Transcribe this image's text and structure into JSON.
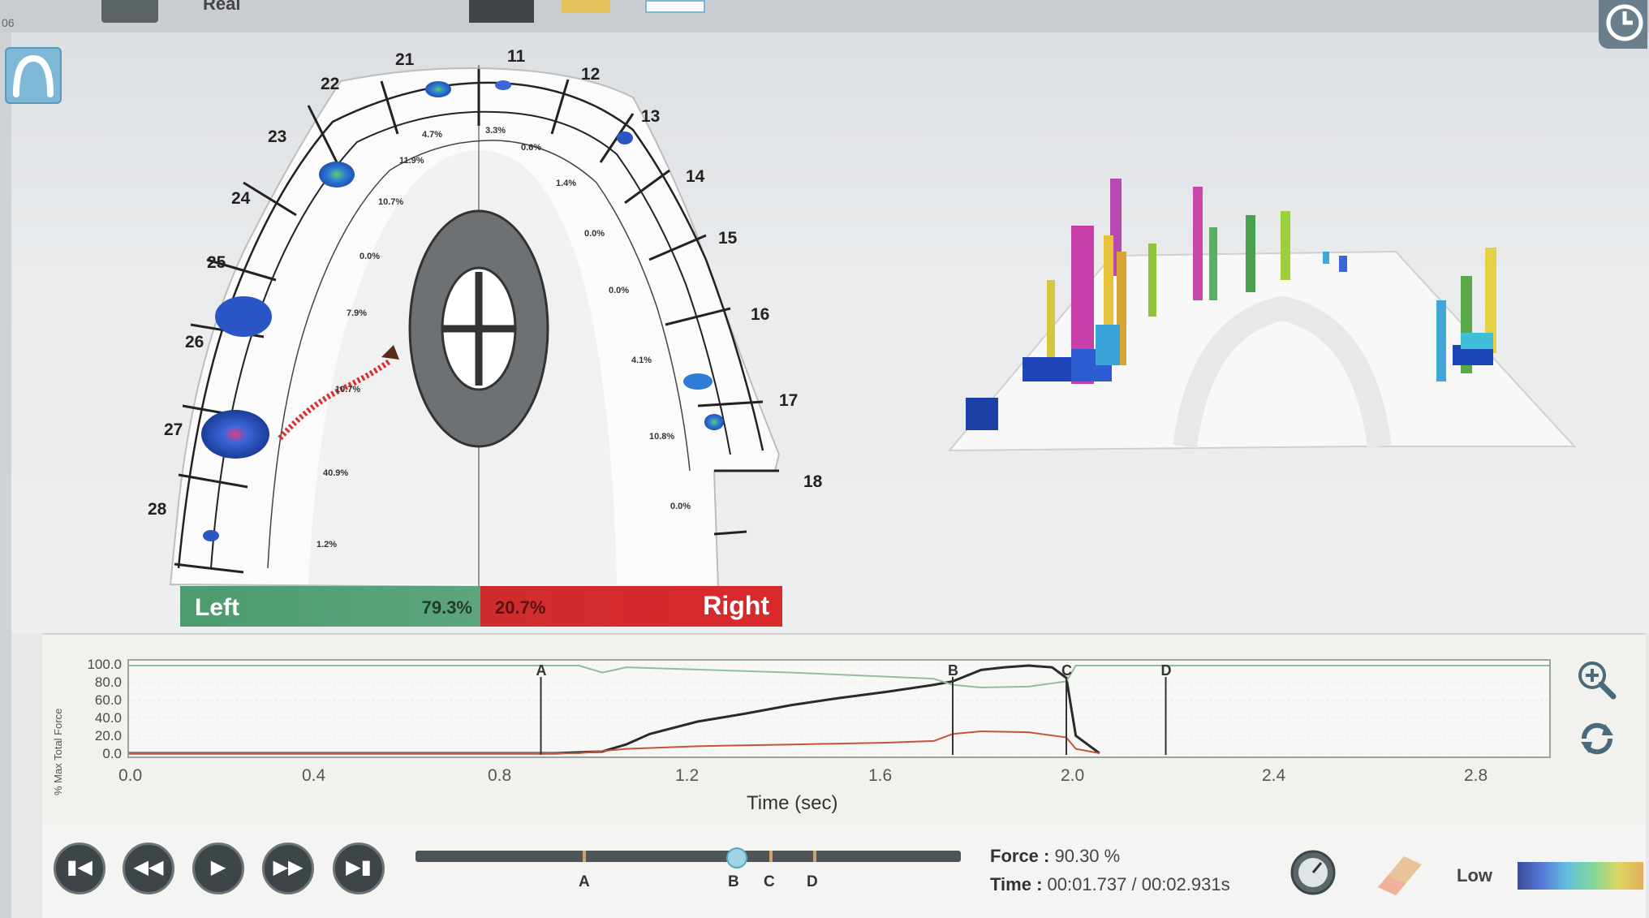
{
  "window": {
    "top_left_text": "06",
    "top_menu_label": "Real"
  },
  "arch": {
    "left_teeth": [
      "21",
      "22",
      "23",
      "24",
      "25",
      "26",
      "27",
      "28"
    ],
    "right_teeth": [
      "11",
      "12",
      "13",
      "14",
      "15",
      "16",
      "17",
      "18"
    ],
    "left_percents": [
      "4.7%",
      "11.9%",
      "10.7%",
      "0.0%",
      "7.9%",
      "10.7%",
      "40.9%",
      "1.2%"
    ],
    "right_percents": [
      "3.3%",
      "0.6%",
      "1.4%",
      "0.0%",
      "0.0%",
      "4.1%",
      "10.8%",
      "0.0%"
    ]
  },
  "balance": {
    "left_label": "Left",
    "left_value": "79.3%",
    "right_label": "Right",
    "right_value": "20.7%",
    "left_color": "#4a9a6e",
    "right_color": "#d8282c"
  },
  "graph": {
    "ylabel": "% Max Total Force",
    "xlabel": "Time (sec)",
    "y_ticks": [
      "100.0",
      "80.0",
      "60.0",
      "40.0",
      "20.0",
      "0.0"
    ],
    "x_ticks": [
      "0.0",
      "0.4",
      "0.8",
      "1.2",
      "1.6",
      "2.0",
      "2.4",
      "2.8"
    ],
    "markers": [
      "A",
      "B",
      "C",
      "D"
    ]
  },
  "chart_data": {
    "type": "line",
    "xlabel": "Time (sec)",
    "ylabel": "% Max Total Force",
    "xlim": [
      0,
      3.0
    ],
    "ylim": [
      0,
      100
    ],
    "markers": [
      {
        "label": "A",
        "x": 0.87
      },
      {
        "label": "B",
        "x": 1.74
      },
      {
        "label": "C",
        "x": 1.98
      },
      {
        "label": "D",
        "x": 2.19
      }
    ],
    "series": [
      {
        "color": "#2a2a2a",
        "x": [
          0.0,
          0.9,
          1.0,
          1.05,
          1.1,
          1.2,
          1.3,
          1.4,
          1.5,
          1.6,
          1.7,
          1.74,
          1.8,
          1.85,
          1.9,
          1.95,
          1.98,
          2.0,
          2.05
        ],
        "y": [
          0,
          0,
          2,
          10,
          22,
          36,
          45,
          55,
          63,
          70,
          78,
          82,
          95,
          98,
          100,
          98,
          86,
          20,
          0
        ]
      },
      {
        "color": "#c5553a",
        "x": [
          0.0,
          0.95,
          1.05,
          1.2,
          1.4,
          1.6,
          1.7,
          1.74,
          1.8,
          1.9,
          1.98,
          2.0,
          2.05
        ],
        "y": [
          0,
          0,
          5,
          8,
          10,
          12,
          14,
          22,
          25,
          24,
          18,
          5,
          0
        ]
      },
      {
        "color": "#8fbf9a",
        "x": [
          0.0,
          0.95,
          1.0,
          1.05,
          1.4,
          1.7,
          1.74,
          1.8,
          1.9,
          1.98,
          2.0,
          2.4,
          3.0
        ],
        "y": [
          100,
          100,
          92,
          98,
          92,
          85,
          78,
          75,
          76,
          82,
          100,
          100,
          100
        ]
      }
    ]
  },
  "playback": {
    "force_label": "Force :",
    "force_value": "90.30 %",
    "time_label": "Time :",
    "time_value": "00:01.737 / 00:02.931s",
    "slider_labels": [
      "A",
      "B",
      "C",
      "D"
    ],
    "scale_label": "Low",
    "slider_position": 0.59
  },
  "icons": [
    "arch-icon",
    "clock-icon",
    "zoom-in-icon",
    "refresh-icon",
    "skip-start-icon",
    "rewind-icon",
    "play-icon",
    "fast-forward-icon",
    "skip-end-icon",
    "gauge-icon",
    "eraser-icon"
  ]
}
